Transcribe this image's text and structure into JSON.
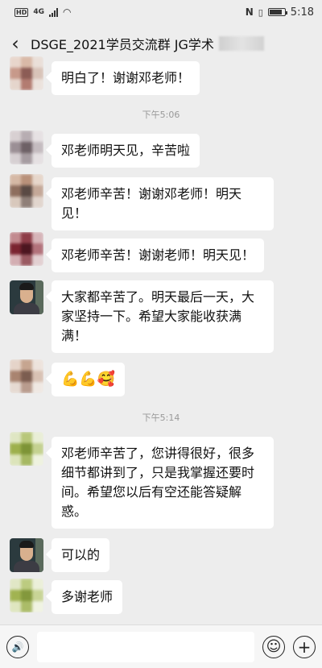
{
  "status_bar": {
    "hd": "HD",
    "network": "4G",
    "time": "5:18"
  },
  "header": {
    "back_icon": "back-arrow-icon",
    "title": "DSGE_2021学员交流群 JG学术"
  },
  "messages": [
    {
      "type": "text",
      "sender": "blurred",
      "text": "明白了！谢谢邓老师！"
    },
    {
      "type": "time",
      "text": "下午5:06"
    },
    {
      "type": "text",
      "sender": "blurred",
      "text": "邓老师明天见，辛苦啦"
    },
    {
      "type": "text",
      "sender": "blurred",
      "text": "邓老师辛苦！谢谢邓老师！明天见！"
    },
    {
      "type": "text",
      "sender": "blurred",
      "text": "邓老师辛苦！谢谢老师！明天见！"
    },
    {
      "type": "text",
      "sender": "teacher",
      "text": "大家都辛苦了。明天最后一天，大家坚持一下。希望大家能收获满满！"
    },
    {
      "type": "emoji",
      "sender": "blurred",
      "emoji": [
        "💪",
        "💪",
        "🥰"
      ]
    },
    {
      "type": "time",
      "text": "下午5:14"
    },
    {
      "type": "text",
      "sender": "blurred",
      "text": "邓老师辛苦了，您讲得很好，很多细节都讲到了，只是我掌握还要时间。希望您以后有空还能答疑解惑。"
    },
    {
      "type": "text",
      "sender": "teacher",
      "text": "可以的"
    },
    {
      "type": "text",
      "sender": "blurred",
      "text": "多谢老师"
    }
  ],
  "input_bar": {
    "voice_icon": "voice-icon",
    "emoji_icon": "emoji-icon",
    "add_icon": "add-icon",
    "voice_glyph": "🔊",
    "emoji_glyph": "☺",
    "add_glyph": "+"
  }
}
